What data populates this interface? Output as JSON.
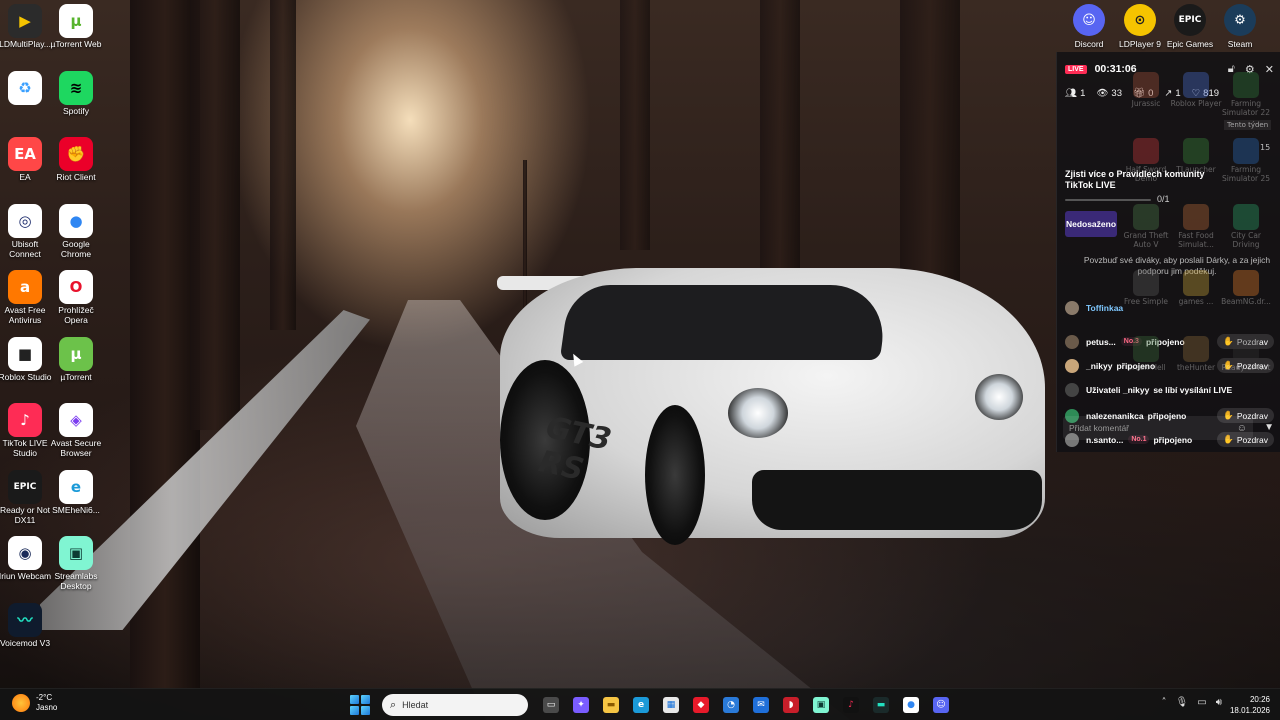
{
  "desktop_left": [
    {
      "label": "LDMultiPlay...",
      "glyph": "▶",
      "color": "#2b2b2b",
      "accent": "#f5c400"
    },
    {
      "label": "µTorrent Web",
      "glyph": "µ",
      "color": "#ffffff",
      "accent": "#57b42d"
    },
    {
      "label": "",
      "glyph": "♻",
      "color": "#ffffff",
      "accent": "#3aa0ff"
    },
    {
      "label": "Spotify",
      "glyph": "≋",
      "color": "#1ed760",
      "accent": "#000000"
    },
    {
      "label": "EA",
      "glyph": "EA",
      "color": "#ff4747",
      "accent": "#ffffff"
    },
    {
      "label": "Riot Client",
      "glyph": "✊",
      "color": "#eb0029",
      "accent": "#ffffff"
    },
    {
      "label": "Ubisoft Connect",
      "glyph": "◎",
      "color": "#ffffff",
      "accent": "#1b2a6b"
    },
    {
      "label": "Google Chrome",
      "glyph": "●",
      "color": "#ffffff",
      "accent": "#2f86f2"
    },
    {
      "label": "Avast Free Antivirus",
      "glyph": "a",
      "color": "#ff7800",
      "accent": "#ffffff"
    },
    {
      "label": "Prohlížeč Opera",
      "glyph": "O",
      "color": "#ffffff",
      "accent": "#e8122c"
    },
    {
      "label": "Roblox Studio",
      "glyph": "■",
      "color": "#ffffff",
      "accent": "#222222"
    },
    {
      "label": "µTorrent",
      "glyph": "µ",
      "color": "#6cc24a",
      "accent": "#ffffff"
    },
    {
      "label": "TikTok LIVE Studio",
      "glyph": "♪",
      "color": "#fe2c55",
      "accent": "#ffffff"
    },
    {
      "label": "Avast Secure Browser",
      "glyph": "◈",
      "color": "#ffffff",
      "accent": "#7b3cf0"
    },
    {
      "label": "Ready or Not DX11",
      "glyph": "EPIC",
      "color": "#1a1a1a",
      "accent": "#ffffff"
    },
    {
      "label": "SMEheNi6...",
      "glyph": "e",
      "color": "#ffffff",
      "accent": "#1b9ad8"
    },
    {
      "label": "Iriun Webcam",
      "glyph": "◉",
      "color": "#ffffff",
      "accent": "#1b2b5a"
    },
    {
      "label": "Streamlabs Desktop",
      "glyph": "▣",
      "color": "#80f5d2",
      "accent": "#0d3b33"
    },
    {
      "label": "Voicemod V3",
      "glyph": "〰",
      "color": "#0f1b2d",
      "accent": "#22e0c0"
    }
  ],
  "desktop_top_right": [
    {
      "label": "Discord",
      "glyph": "☺",
      "color": "#5865f2"
    },
    {
      "label": "LDPlayer 9",
      "glyph": "⊙",
      "color": "#f5c400"
    },
    {
      "label": "Epic Games",
      "glyph": "EPIC",
      "color": "#1a1a1a"
    },
    {
      "label": "Steam",
      "glyph": "⚙",
      "color": "#1b3c5a"
    }
  ],
  "wallpaper": {
    "car_text": "GT3 RS"
  },
  "live_panel": {
    "badge": "LIVE",
    "timer": "00:31:06",
    "stats": {
      "viewers_icon": "people-icon",
      "viewers": "1",
      "views": "33",
      "gifts": "0",
      "shares": "1",
      "likes": "819"
    },
    "rules_text": "Zjisti více o Pravidlech komunity TikTok LIVE",
    "goal_progress_text": "0/1",
    "goal_progress": 0,
    "goal_tag": "Nedosaženo",
    "goal_message": "Povzbuď své diváky, aby poslali Dárky, a za jejich podporu jim poděkuj.",
    "chat": [
      {
        "name": "Toffinkaa",
        "text": "",
        "rank": "",
        "greet": "",
        "avatar": "#8a7a6a"
      },
      {
        "name": "petus...",
        "text": "připojeno",
        "rank": "No.3",
        "greet": "Pozdrav",
        "avatar": "#6a5a4a"
      },
      {
        "name": "_nikyy",
        "text": "připojeno",
        "rank": "",
        "greet": "Pozdrav",
        "avatar": "#c9a67a"
      },
      {
        "name": "Uživateli _nikyy",
        "text": "se líbí vysílání LIVE",
        "rank": "",
        "greet": "",
        "avatar": "#444444"
      },
      {
        "name": "nalezenanikca",
        "text": "připojeno",
        "rank": "",
        "greet": "Pozdrav",
        "avatar": "#2e8b57"
      },
      {
        "name": "n.santo...",
        "text": "připojeno",
        "rank": "No.1",
        "greet": "Pozdrav",
        "avatar": "#777777"
      }
    ],
    "comment_placeholder": "Přidat komentář"
  },
  "ghost_apps": [
    {
      "label": "Jurassic",
      "color": "#a5523a"
    },
    {
      "label": "Roblox Player",
      "color": "#4a6fd1"
    },
    {
      "label": "Farming Simulator 22",
      "color": "#2f7b3b"
    },
    {
      "label": "Half Sword Demo",
      "color": "#c83a3a"
    },
    {
      "label": "TLauncher",
      "color": "#3a8a3a"
    },
    {
      "label": "Farming Simulator 25",
      "color": "#2a6bb8"
    },
    {
      "label": "Grand Theft Auto V",
      "color": "#4a7a4a"
    },
    {
      "label": "Fast Food Simulat...",
      "color": "#b86a3a"
    },
    {
      "label": "City Car Driving",
      "color": "#2aa36a"
    },
    {
      "label": "Free Simple",
      "color": "#5a5a5a"
    },
    {
      "label": "games ...",
      "color": "#c8a23a"
    },
    {
      "label": "BeamNG.dr...",
      "color": "#e07b2a"
    },
    {
      "label": "Green Hell",
      "color": "#3a6a3a"
    },
    {
      "label": "theHunter",
      "color": "#8a6a3a"
    },
    {
      "label": "Ready or Not",
      "color": "#333333"
    }
  ],
  "ghost_misc": {
    "tag": "Tento týden",
    "count": "15"
  },
  "taskbar": {
    "weather_temp": "-2°C",
    "weather_desc": "Jasno",
    "search_placeholder": "Hledat",
    "apps": [
      {
        "name": "task-view-icon",
        "glyph": "▭",
        "bg": "#4a4a4a",
        "fg": "#ffffff"
      },
      {
        "name": "copilot-icon",
        "glyph": "✦",
        "bg": "#7a5cff",
        "fg": "#ffffff"
      },
      {
        "name": "file-explorer-icon",
        "glyph": "▬",
        "bg": "#f6c544",
        "fg": "#8a5a00"
      },
      {
        "name": "edge-icon",
        "glyph": "e",
        "bg": "#1b9ad8",
        "fg": "#ffffff"
      },
      {
        "name": "store-icon",
        "glyph": "▦",
        "bg": "#e8e8e8",
        "fg": "#0a6ad9"
      },
      {
        "name": "red-app-icon",
        "glyph": "◆",
        "bg": "#e81a2a",
        "fg": "#ffffff"
      },
      {
        "name": "chat-app-icon",
        "glyph": "◔",
        "bg": "#2a7ad8",
        "fg": "#ffffff"
      },
      {
        "name": "mail-icon",
        "glyph": "✉",
        "bg": "#1f6fd9",
        "fg": "#ffffff"
      },
      {
        "name": "shield-app-icon",
        "glyph": "◗",
        "bg": "#c81e2a",
        "fg": "#ffffff"
      },
      {
        "name": "streamlabs-icon",
        "glyph": "▣",
        "bg": "#80f5d2",
        "fg": "#0d3b33"
      },
      {
        "name": "tiktok-icon",
        "glyph": "♪",
        "bg": "#111111",
        "fg": "#fe2c55"
      },
      {
        "name": "terminal-icon",
        "glyph": "▬",
        "bg": "#1a2a2a",
        "fg": "#22e0c0"
      },
      {
        "name": "chrome-icon",
        "glyph": "●",
        "bg": "#ffffff",
        "fg": "#2f86f2"
      },
      {
        "name": "discord-icon",
        "glyph": "☺",
        "bg": "#5865f2",
        "fg": "#ffffff"
      }
    ],
    "time": "20:26",
    "date": "18.01.2026"
  }
}
